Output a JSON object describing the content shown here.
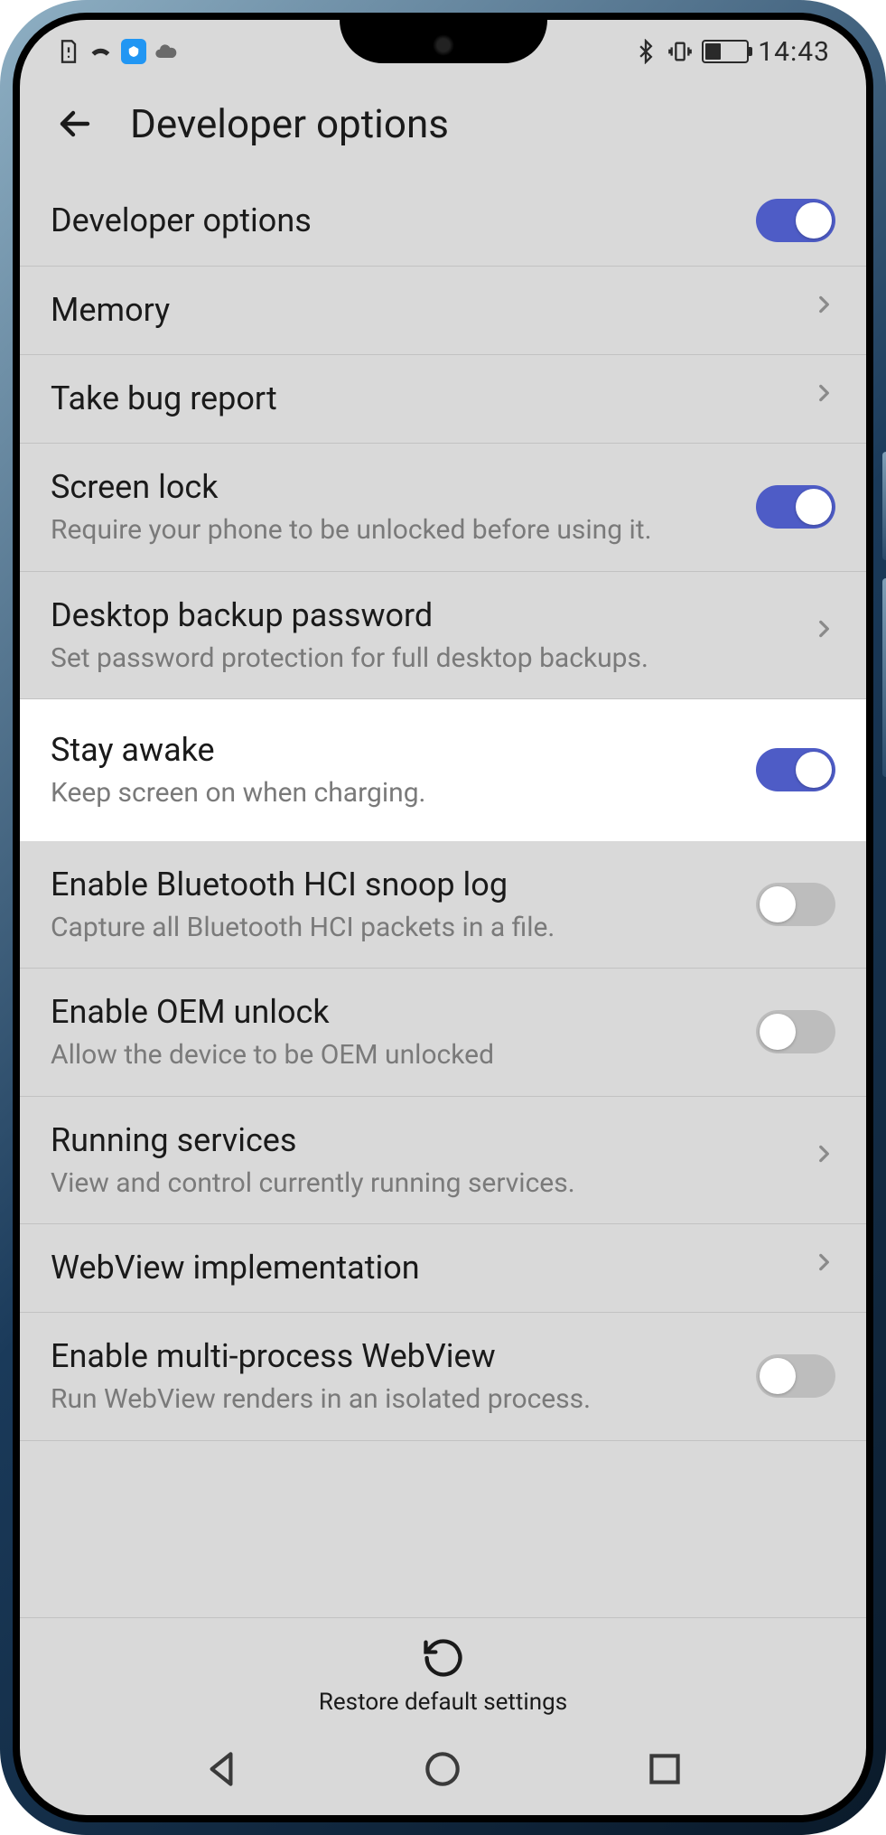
{
  "status": {
    "time": "14:43",
    "left_icons": [
      "doc-alert-icon",
      "signal-icon",
      "app-icon",
      "cloud-icon"
    ],
    "right_icons": [
      "bluetooth-icon",
      "vibrate-icon",
      "battery-icon"
    ]
  },
  "header": {
    "title": "Developer options"
  },
  "rows": [
    {
      "key": "developer-options",
      "title": "Developer options",
      "sub": "",
      "control": "toggle",
      "state": "on"
    },
    {
      "key": "memory",
      "title": "Memory",
      "sub": "",
      "control": "chevron"
    },
    {
      "key": "take-bug-report",
      "title": "Take bug report",
      "sub": "",
      "control": "chevron"
    },
    {
      "key": "screen-lock",
      "title": "Screen lock",
      "sub": "Require your phone to be unlocked before using it.",
      "control": "toggle",
      "state": "on"
    },
    {
      "key": "desktop-backup-password",
      "title": "Desktop backup password",
      "sub": "Set password protection for full desktop backups.",
      "control": "chevron"
    },
    {
      "key": "stay-awake",
      "title": "Stay awake",
      "sub": "Keep screen on when charging.",
      "control": "toggle",
      "state": "on",
      "highlight": true
    },
    {
      "key": "enable-bluetooth-hci",
      "title": "Enable Bluetooth HCI snoop log",
      "sub": "Capture all Bluetooth HCI packets in a file.",
      "control": "toggle",
      "state": "off"
    },
    {
      "key": "enable-oem-unlock",
      "title": "Enable OEM unlock",
      "sub": "Allow the device to be OEM unlocked",
      "control": "toggle",
      "state": "off"
    },
    {
      "key": "running-services",
      "title": "Running services",
      "sub": "View and control currently running services.",
      "control": "chevron"
    },
    {
      "key": "webview-implementation",
      "title": "WebView implementation",
      "sub": "",
      "control": "chevron"
    },
    {
      "key": "enable-multiprocess-webview",
      "title": "Enable multi-process WebView",
      "sub": "Run WebView renders in an isolated process.",
      "control": "toggle",
      "state": "off"
    }
  ],
  "restore": {
    "label": "Restore default settings"
  },
  "colors": {
    "accent": "#4e5cc6",
    "screen_bg": "#d9d9d9",
    "highlight_bg": "#ffffff"
  }
}
